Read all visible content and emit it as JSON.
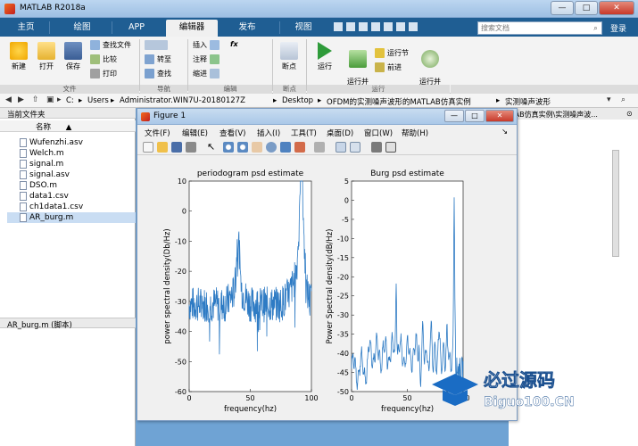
{
  "window": {
    "title": "MATLAB R2018a",
    "min": "—",
    "max": "□",
    "close": "✕"
  },
  "tabs": [
    "主页",
    "绘图",
    "APP",
    "编辑器",
    "发布",
    "视图"
  ],
  "search": {
    "placeholder": "搜索文档",
    "login": "登录"
  },
  "ribbon": {
    "file": {
      "new": "新建",
      "open": "打开",
      "save": "保存",
      "find_files": "查找文件",
      "compare": "比较",
      "print": "打印",
      "group": "文件"
    },
    "navigate": {
      "goto": "转至",
      "find": "查找",
      "group": "导航"
    },
    "edit": {
      "insert": "插入",
      "fx": "fx",
      "comment": "注释",
      "indent": "缩进",
      "group": "编辑"
    },
    "breakpoints": {
      "label": "断点",
      "group": "断点"
    },
    "run": {
      "run": "运行",
      "run_advance": "运行并\n前进",
      "run_section": "运行节",
      "advance": "前进",
      "run_time": "运行并\n计时",
      "group": "运行"
    }
  },
  "address": {
    "parts": [
      "C:",
      "Users",
      "Administrator.WIN7U-20180127Z",
      "Desktop",
      "OFDM的实测噪声波形的MATLAB仿真实例",
      "实测噪声波形"
    ]
  },
  "left_panel": {
    "header": "当前文件夹",
    "col_name": "名称",
    "sort": "▲",
    "files": [
      "Wufenzhi.asv",
      "Welch.m",
      "signal.m",
      "signal.asv",
      "DSO.m",
      "data1.csv",
      "ch1data1.csv",
      "AR_burg.m"
    ],
    "selected": "AR_burg.m",
    "detail": "AR_burg.m  (脚本)"
  },
  "right_panel": {
    "header": "LAB仿真实例\\实测噪声波..."
  },
  "figure": {
    "title": "Figure 1",
    "menu": [
      "文件(F)",
      "编辑(E)",
      "查看(V)",
      "插入(I)",
      "工具(T)",
      "桌面(D)",
      "窗口(W)",
      "帮助(H)"
    ]
  },
  "chart_data": [
    {
      "type": "line",
      "title": "periodogram psd estimate",
      "xlabel": "frequency(hz)",
      "ylabel": "power spectral density(Db/Hz)",
      "xlim": [
        0,
        100
      ],
      "ylim": [
        -60,
        10
      ],
      "xticks": [
        0,
        50,
        100
      ],
      "yticks": [
        -60,
        -50,
        -40,
        -30,
        -20,
        -10,
        0,
        10
      ],
      "color": "#2e7bc4",
      "peaks": [
        {
          "x": 40,
          "y": -12
        },
        {
          "x": 92,
          "y": 7
        }
      ],
      "baseline": -31
    },
    {
      "type": "line",
      "title": "Burg psd estimate",
      "xlabel": "frequency(hz)",
      "ylabel": "Power Spectral density(dB/Hz)",
      "xlim": [
        0,
        100
      ],
      "ylim": [
        -50,
        5
      ],
      "xticks": [
        0,
        50,
        100
      ],
      "yticks": [
        -50,
        -45,
        -40,
        -35,
        -30,
        -25,
        -20,
        -15,
        -10,
        -5,
        0,
        5
      ],
      "color": "#2e7bc4",
      "peaks": [
        {
          "x": 40,
          "y": -17
        },
        {
          "x": 92,
          "y": -1
        }
      ],
      "baseline": -40
    }
  ],
  "logo": {
    "cn": "必过源码",
    "url": "Biguo100.CN"
  }
}
